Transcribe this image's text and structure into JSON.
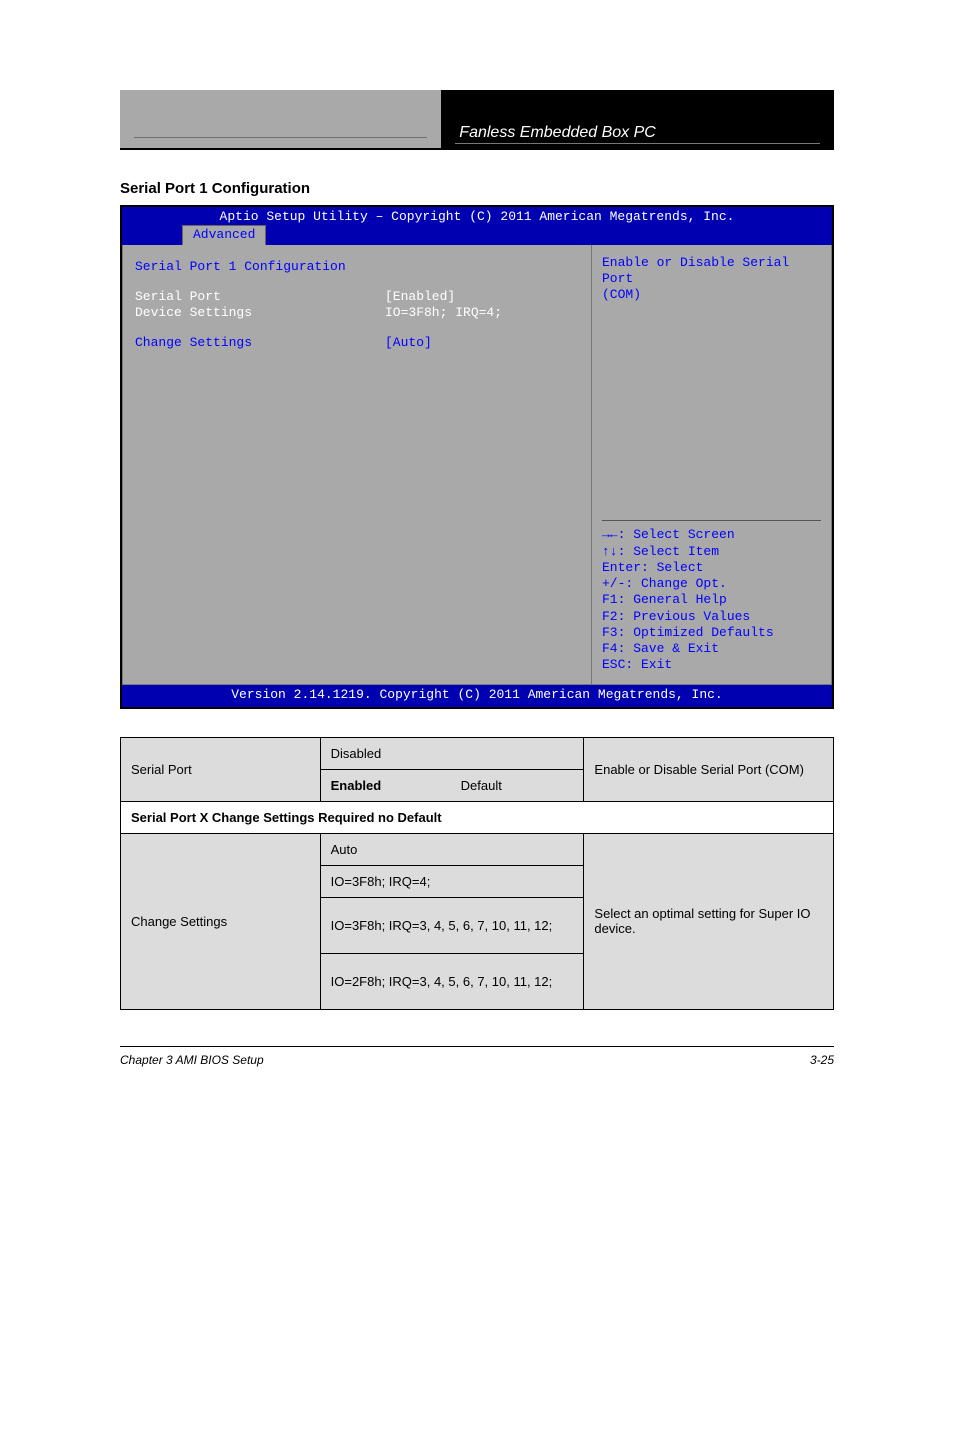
{
  "header": {
    "right_title": "Fanless Embedded Box PC"
  },
  "section_title": "Serial Port 1 Configuration",
  "bios": {
    "top": "Aptio Setup Utility – Copyright (C) 2011 American Megatrends, Inc.",
    "tab": "Advanced",
    "heading": "Serial Port 1 Configuration",
    "rows": [
      {
        "label": "Serial Port",
        "value": "[Enabled]",
        "style": "white"
      },
      {
        "label": "Device Settings",
        "value": "IO=3F8h; IRQ=4;",
        "style": "white"
      }
    ],
    "change_row": {
      "label": "Change Settings",
      "value": "[Auto]"
    },
    "side_desc": [
      "Enable or Disable Serial Port",
      "(COM)"
    ],
    "keys": [
      "→←: Select Screen",
      "↑↓: Select Item",
      "Enter: Select",
      "+/-: Change Opt.",
      "F1: General Help",
      "F2: Previous Values",
      "F3: Optimized Defaults",
      "F4: Save & Exit",
      "ESC: Exit"
    ],
    "footer": "Version 2.14.1219. Copyright (C) 2011 American Megatrends, Inc."
  },
  "table": {
    "r1": {
      "c1": "Serial Port",
      "c2a": "Disabled",
      "c2b_prefix": "Enabled",
      "c2b_suffix": "Default",
      "c3": "Enable or Disable Serial Port (COM)"
    },
    "banner": "Serial Port X Change Settings Required no Default",
    "r2": {
      "c1": "Change Settings",
      "opts": [
        "Auto",
        "IO=3F8h; IRQ=4;",
        "IO=3F8h; IRQ=3, 4, 5, 6, 7, 10, 11, 12;",
        "IO=2F8h; IRQ=3, 4, 5, 6, 7, 10, 11, 12;"
      ],
      "c3": "Select an optimal setting for Super IO device."
    }
  },
  "pgfoot": {
    "left": "Chapter 3 AMI BIOS Setup",
    "right": "3-25"
  }
}
